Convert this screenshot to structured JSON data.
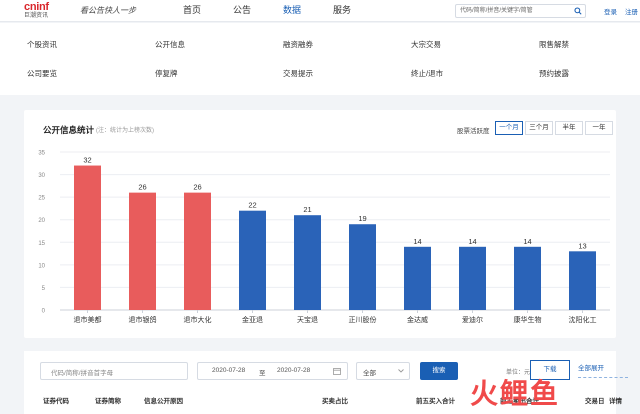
{
  "header": {
    "logo_mark": "cninf",
    "logo_sub": "巨潮资讯",
    "slogan": "看公告快人一步",
    "nav": [
      "首页",
      "公告",
      "数据",
      "服务"
    ],
    "nav_active": 2,
    "search_placeholder": "代码/简称/拼音/关键字/简管",
    "login": "登录",
    "register": "注册"
  },
  "submenu": {
    "items": [
      "个股资讯",
      "公开信息",
      "融资融券",
      "大宗交易",
      "限售解禁",
      "公司要览",
      "停复牌",
      "交易提示",
      "终止/退市",
      "预约披露"
    ]
  },
  "panel": {
    "title": "公开信息统计",
    "note": "(注：统计为上榜次数)",
    "period_label": "股票活跃度",
    "periods": [
      "一个月",
      "三个月",
      "半年",
      "一年"
    ],
    "period_active": 0
  },
  "chart_data": {
    "type": "bar",
    "categories": [
      "退市美都",
      "退市银鸽",
      "退市大化",
      "金亚退",
      "天宝退",
      "正川股份",
      "金达威",
      "爱迪尔",
      "康华生物",
      "沈阳化工"
    ],
    "values": [
      32,
      26,
      26,
      22,
      21,
      19,
      14,
      14,
      14,
      13
    ],
    "colors": [
      "#e85c5c",
      "#e85c5c",
      "#e85c5c",
      "#2a63b8",
      "#2a63b8",
      "#2a63b8",
      "#2a63b8",
      "#2a63b8",
      "#2a63b8",
      "#2a63b8"
    ],
    "ylim": [
      0,
      35
    ],
    "yticks": [
      0,
      5,
      10,
      15,
      20,
      25,
      30,
      35
    ],
    "grid": true,
    "title": "",
    "xlabel": "",
    "ylabel": ""
  },
  "filter": {
    "code_placeholder": "代码/简称/拼音首字母",
    "date_from": "2020-07-28",
    "date_sep": "至",
    "date_to": "2020-07-28",
    "scope": "全部",
    "search_label": "搜索",
    "unit_label": "单位：元",
    "download_label": "下载",
    "expand_label": "全部展开"
  },
  "table": {
    "headers": [
      "证券代码",
      "证券简称",
      "信息公开原因",
      "买卖占比",
      "前五买入合计",
      "前五卖出合计",
      "交易日",
      "详情"
    ]
  },
  "watermark": "火鲤鱼",
  "colors": {
    "accent": "#1a5fb4",
    "red_bar": "#e85c5c",
    "blue_bar": "#2a63b8"
  }
}
